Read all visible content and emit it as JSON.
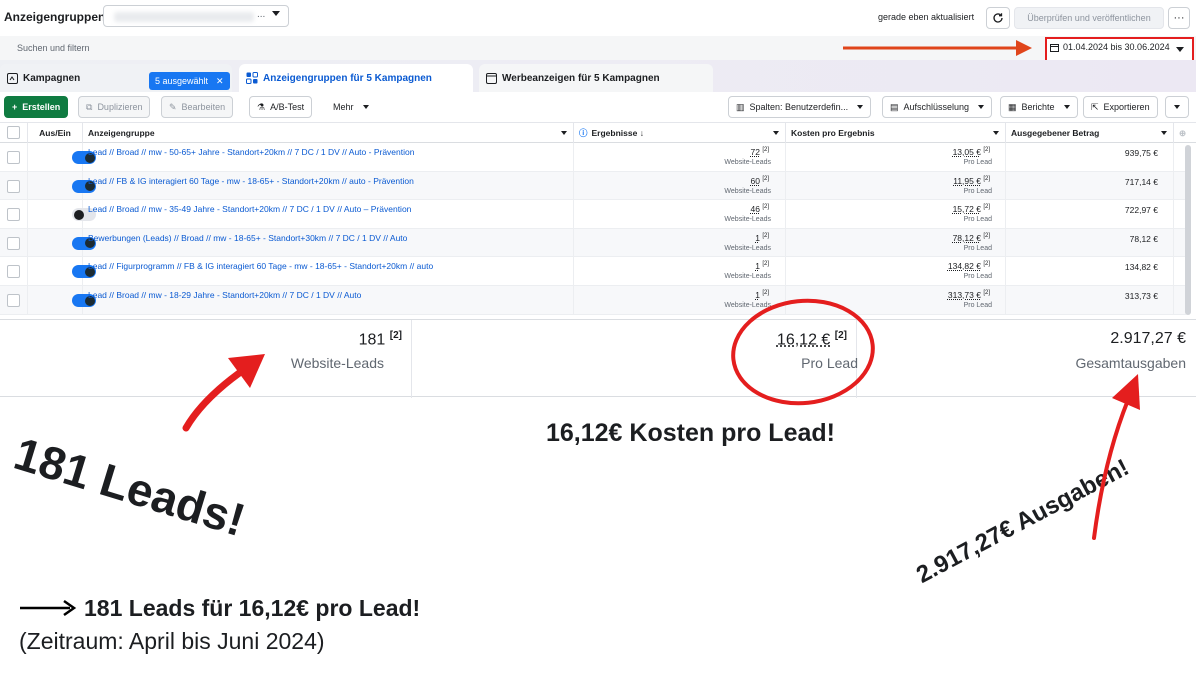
{
  "header": {
    "title": "Anzeigengruppen",
    "status": "gerade eben aktualisiert",
    "publish_label": "Überprüfen und veröffentlichen",
    "more_label": "···",
    "selector_suffix": "..."
  },
  "search": {
    "placeholder": "Suchen und filtern"
  },
  "date_range": "01.04.2024 bis 30.06.2024",
  "tabs": {
    "campaigns": "Kampagnen",
    "selected_badge": "5 ausgewählt",
    "adsets": "Anzeigengruppen für 5 Kampagnen",
    "ads": "Werbeanzeigen für 5 Kampagnen"
  },
  "toolbar": {
    "create": "Erstellen",
    "duplicate": "Duplizieren",
    "edit": "Bearbeiten",
    "ab_test": "A/B-Test",
    "more": "Mehr",
    "columns": "Spalten: Benutzerdefin...",
    "breakdown": "Aufschlüsselung",
    "reports": "Berichte",
    "export": "Exportieren"
  },
  "columns": {
    "onoff": "Aus/Ein",
    "adset": "Anzeigengruppe",
    "results": "Ergebnisse ↓",
    "cost": "Kosten pro Ergebnis",
    "spent": "Ausgegebener Betrag"
  },
  "rows": [
    {
      "name": "Lead // Broad // mw - 50-65+ Jahre - Standort+20km // 7 DC / 1 DV // Auto - Prävention",
      "on": true,
      "results": "72",
      "results_sub": "Website-Leads",
      "cost": "13,05 €",
      "cost_sub": "Pro Lead",
      "spent": "939,75 €",
      "ref": "[2]"
    },
    {
      "name": "Lead // FB & IG interagiert 60 Tage - mw - 18-65+ - Standort+20km // auto - Prävention",
      "on": true,
      "results": "60",
      "results_sub": "Website-Leads",
      "cost": "11,95 €",
      "cost_sub": "Pro Lead",
      "spent": "717,14 €",
      "ref": "[2]"
    },
    {
      "name": "Lead // Broad // mw - 35-49 Jahre - Standort+20km // 7 DC / 1 DV // Auto – Prävention",
      "on": false,
      "results": "46",
      "results_sub": "Website-Leads",
      "cost": "15,72 €",
      "cost_sub": "Pro Lead",
      "spent": "722,97 €",
      "ref": "[2]"
    },
    {
      "name": "Bewerbungen (Leads) // Broad // mw - 18-65+ - Standort+30km // 7 DC / 1 DV // Auto",
      "on": true,
      "results": "1",
      "results_sub": "Website-Leads",
      "cost": "78,12 €",
      "cost_sub": "Pro Lead",
      "spent": "78,12 €",
      "ref": "[2]"
    },
    {
      "name": "Lead // Figurprogramm // FB & IG interagiert 60 Tage - mw - 18-65+ - Standort+20km // auto",
      "on": true,
      "results": "1",
      "results_sub": "Website-Leads",
      "cost": "134,82 €",
      "cost_sub": "Pro Lead",
      "spent": "134,82 €",
      "ref": "[2]"
    },
    {
      "name": "Lead // Broad // mw - 18-29 Jahre - Standort+20km // 7 DC / 1 DV // Auto",
      "on": true,
      "results": "1",
      "results_sub": "Website-Leads",
      "cost": "313,73 €",
      "cost_sub": "Pro Lead",
      "spent": "313,73 €",
      "ref": "[2]"
    }
  ],
  "summary": {
    "results": "181",
    "results_ref": "[2]",
    "results_label": "Website-Leads",
    "cost": "16,12 €",
    "cost_ref": "[2]",
    "cost_label": "Pro Lead",
    "spent": "2.917,27 €",
    "spent_label": "Gesamtausgaben"
  },
  "annotations": {
    "big": "181 Leads!",
    "cost": "16,12€ Kosten pro Lead!",
    "spend": "2.917,27€ Ausgaben!",
    "line1": "181 Leads für 16,12€ pro Lead!",
    "line2": "(Zeitraum: April bis Juni 2024)"
  },
  "colors": {
    "accent": "#1877f2",
    "link": "#0a5ad2",
    "create": "#0f7b41",
    "annotation_red": "#e41e1e",
    "annotation_orange": "#e0451b"
  }
}
